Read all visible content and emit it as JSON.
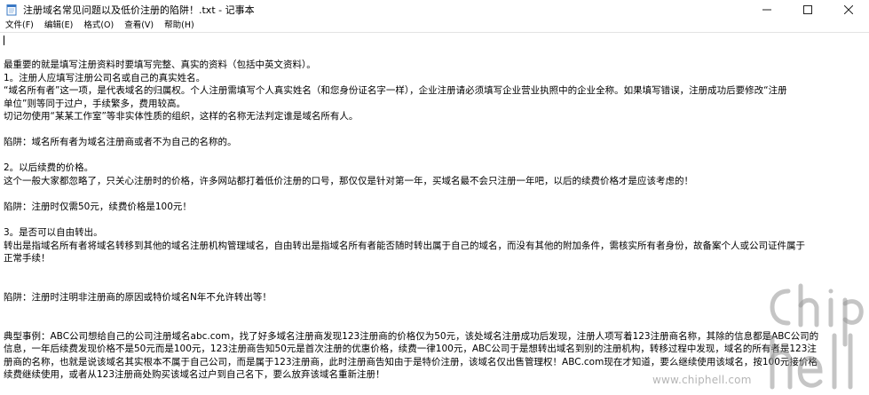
{
  "window": {
    "title": "注册域名常见问题以及低价注册的陷阱！.txt - 记事本",
    "controls": {
      "minimize": "─",
      "maximize": "☐",
      "close": "✕"
    }
  },
  "menu": {
    "items": [
      {
        "id": "file",
        "label": "文件(F)"
      },
      {
        "id": "edit",
        "label": "编辑(E)"
      },
      {
        "id": "format",
        "label": "格式(O)"
      },
      {
        "id": "view",
        "label": "查看(V)"
      },
      {
        "id": "help",
        "label": "帮助(H)"
      }
    ]
  },
  "document": {
    "lines": [
      "最重要的就是填写注册资料时要填写完整、真实的资料（包括中英文资料）。",
      "1。注册人应填写注册公司名或自己的真实姓名。",
      "“域名所有者”这一项，是代表域名的归属权。个人注册需填写个人真实姓名（和您身份证名字一样），企业注册请必须填写企业营业执照中的企业全称。如果填写错误，注册成功后要修改“注册",
      "单位”则等同于过户，手续繁多，费用较高。",
      "切记勿使用“某某工作室”等非实体性质的组织，这样的名称无法判定谁是域名所有人。",
      "",
      "陷阱：域名所有者为域名注册商或者不为自己的名称的。",
      "",
      "2。以后续费的价格。",
      "这个一般大家都忽略了，只关心注册时的价格，许多网站都打着低价注册的口号，那仅仅是针对第一年，买域名最不会只注册一年吧，以后的续费价格才是应该考虑的！",
      "",
      "陷阱：注册时仅需50元，续费价格是100元！",
      "",
      "3。是否可以自由转出。",
      "转出是指域名所有者将域名转移到其他的域名注册机构管理域名，自由转出是指域名所有者能否随时转出属于自己的域名，而没有其他的附加条件，需核实所有者身份，故备案个人或公司证件属于",
      "正常手续！",
      "",
      "",
      "陷阱：注册时注明非注册商的原因或特价域名N年不允许转出等！",
      "",
      "",
      "典型事例：ABC公司想给自己的公司注册域名abc.com，找了好多域名注册商发现123注册商的价格仅为50元，该处域名注册成功后发现，注册人项写着123注册商名称，其除的信息都是ABC公司的",
      "信息，一年后续费发现价格不是50元而是100元，123注册商告知50元是首次注册的优惠价格，续费一律100元，ABC公司于是想转出域名到别的注册机构，转移过程中发现，域名的所有者是123注",
      "册商的名称，也就是说该域名其实根本不属于自己公司，而是属于123注册商，此时注册商告知由于是特价注册，该域名仅出售管理权！ABC.com现在才知道，要么继续使用该域名，按100元接价格",
      "续费继续使用，或者从123注册商处购买该域名过户到自己名下，要么放弃该域名重新注册！"
    ]
  },
  "watermark": {
    "site": "www.chiphell.com"
  },
  "colors": {
    "background": "#ffffff",
    "text": "#000000",
    "watermark": "#8a8a8a"
  }
}
